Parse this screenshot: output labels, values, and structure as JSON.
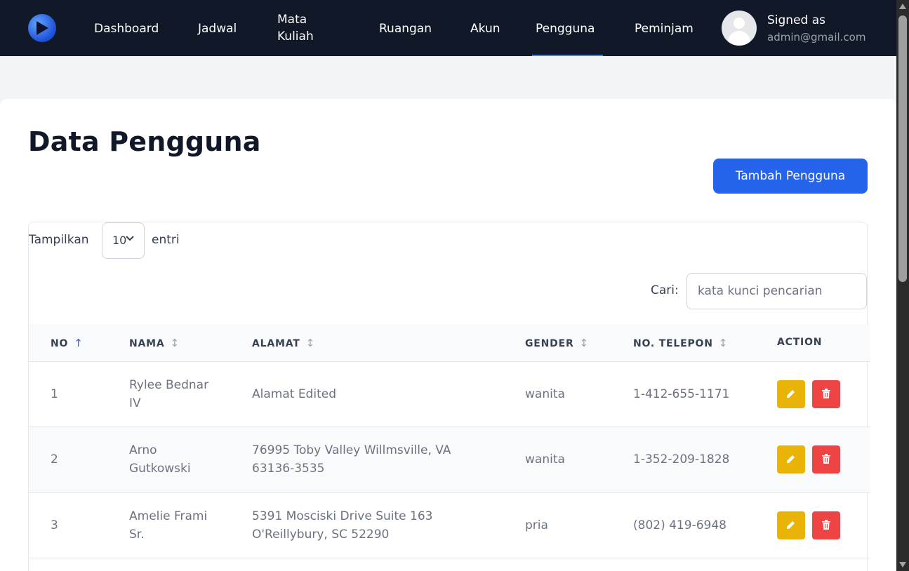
{
  "nav": {
    "items": [
      {
        "label": "Dashboard"
      },
      {
        "label": "Jadwal"
      },
      {
        "label": "Mata Kuliah"
      },
      {
        "label": "Ruangan"
      },
      {
        "label": "Akun"
      },
      {
        "label": "Pengguna",
        "active": true
      },
      {
        "label": "Peminjam"
      }
    ],
    "user": {
      "signed_as": "Signed as",
      "email": "admin@gmail.com"
    }
  },
  "page": {
    "title": "Data Pengguna",
    "add_button": "Tambah Pengguna"
  },
  "table_controls": {
    "show_label": "Tampilkan",
    "entries_value": "10",
    "entries_label": "entri",
    "search_label": "Cari:",
    "search_placeholder": "kata kunci pencarian"
  },
  "table": {
    "columns": [
      "NO",
      "NAMA",
      "ALAMAT",
      "GENDER",
      "NO. TELEPON",
      "ACTION"
    ],
    "rows": [
      {
        "no": "1",
        "nama": "Rylee Bednar IV",
        "alamat": "Alamat Edited",
        "gender": "wanita",
        "telepon": "1-412-655-1171"
      },
      {
        "no": "2",
        "nama": "Arno Gutkowski",
        "alamat": "76995 Toby Valley Willmsville, VA 63136-3535",
        "gender": "wanita",
        "telepon": "1-352-209-1828"
      },
      {
        "no": "3",
        "nama": "Amelie Frami Sr.",
        "alamat": "5391 Mosciski Drive Suite 163 O'Reillybury, SC 52290",
        "gender": "pria",
        "telepon": "(802) 419-6948"
      }
    ]
  },
  "colors": {
    "navbar": "#111827",
    "primary": "#2563eb",
    "edit": "#eab308",
    "delete": "#ef4444"
  }
}
